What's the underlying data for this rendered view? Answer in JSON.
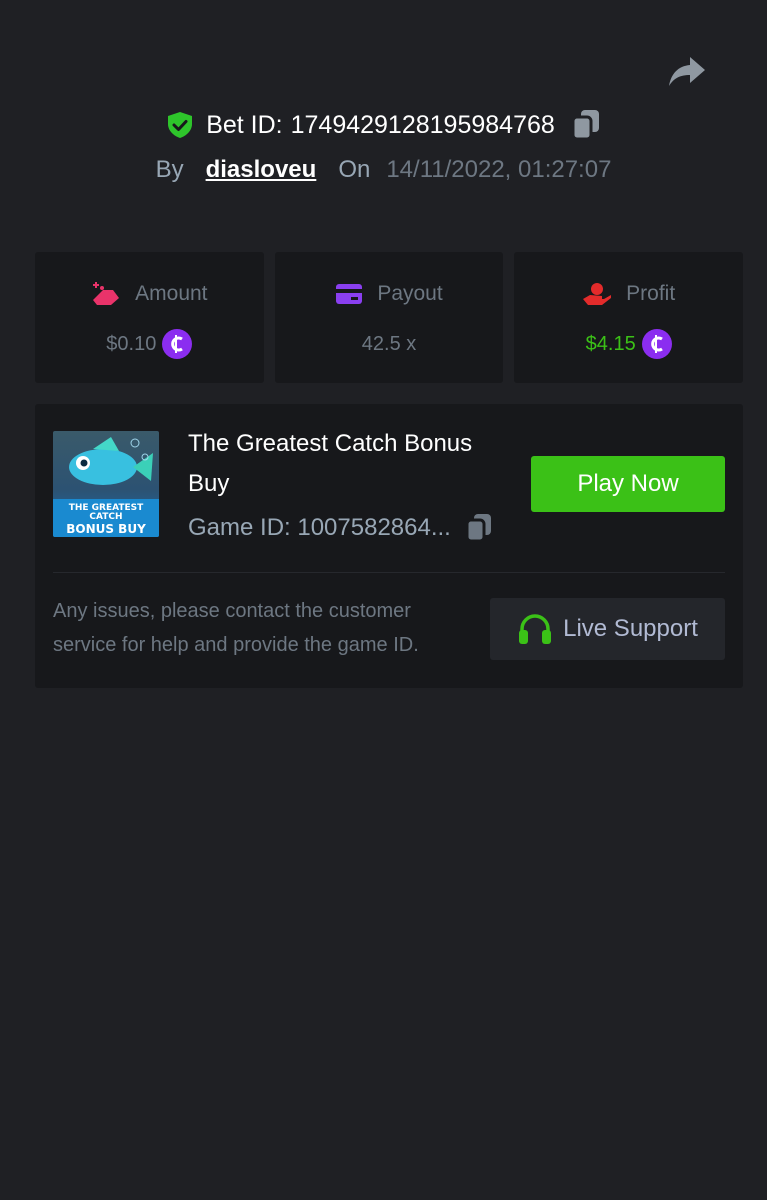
{
  "header": {
    "bet_label": "Bet ID:",
    "bet_id": "174942912819598476​8",
    "by_label": "By",
    "username": "diasloveu",
    "on_label": "On",
    "datetime": "14/11/2022, 01:27:07"
  },
  "stats": {
    "amount": {
      "label": "Amount",
      "value": "$0.10",
      "icon": "coins-hand-icon"
    },
    "payout": {
      "label": "Payout",
      "value": "42.5 x",
      "icon": "card-icon"
    },
    "profit": {
      "label": "Profit",
      "value": "$4.15",
      "icon": "money-hand-icon"
    }
  },
  "game": {
    "title": "The Greatest Catch Bonus Buy",
    "game_id": "Game ID: 1007582864...",
    "thumb_line1": "THE GREATEST CATCH",
    "thumb_line2": "BONUS BUY",
    "play_label": "Play Now"
  },
  "support": {
    "help_text": "Any issues, please contact the customer service for help and provide the game ID.",
    "button_label": "Live Support"
  },
  "colors": {
    "background": "#1f2024",
    "card": "#17181b",
    "accent_green": "#3bc117",
    "coin_purple": "#8b2df0",
    "amount_pink": "#e9336a",
    "payout_purple": "#8a3ff0",
    "profit_red": "#e32b2b"
  }
}
